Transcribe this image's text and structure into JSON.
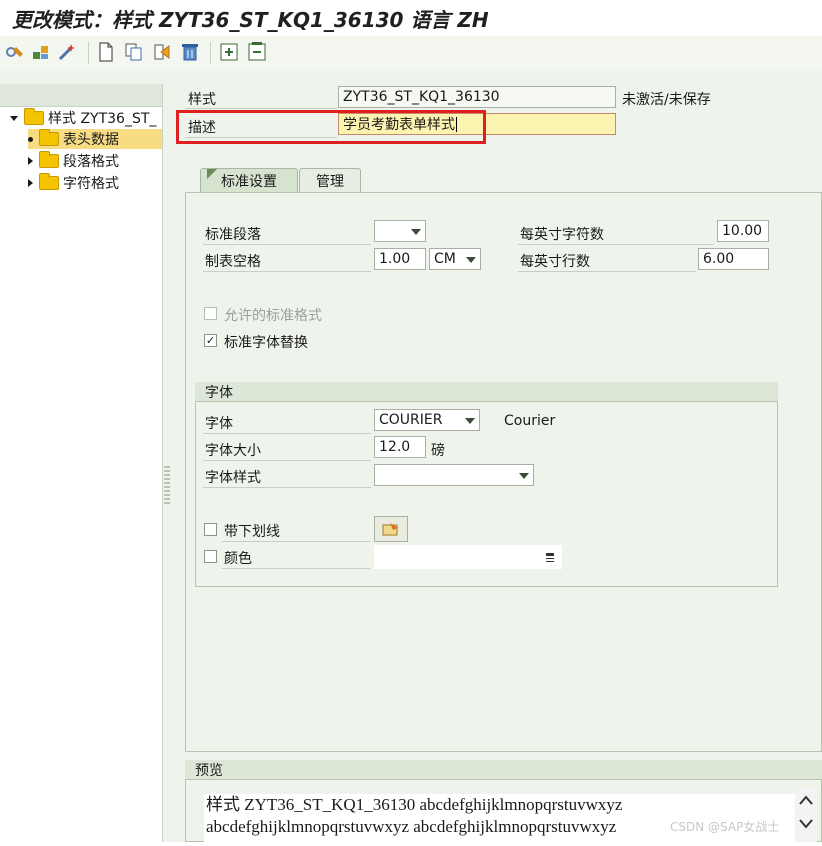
{
  "window": {
    "title": "更改模式：样式 ZYT36_ST_KQ1_36130 语言 ZH"
  },
  "tree": {
    "items": [
      {
        "label": "样式 ZYT36_ST_"
      },
      {
        "label": "表头数据"
      },
      {
        "label": "段落格式"
      },
      {
        "label": "字符格式"
      }
    ]
  },
  "header": {
    "style_label": "样式",
    "style_value": "ZYT36_ST_KQ1_36130",
    "status_text": "未激活/未保存",
    "desc_label": "描述",
    "desc_value": "学员考勤表单样式"
  },
  "tabs": [
    {
      "label": "标准设置",
      "active": true
    },
    {
      "label": "管理",
      "active": false
    }
  ],
  "standard": {
    "std_paragraph_label": "标准段落",
    "std_paragraph_value": "",
    "tab_spacing_label": "制表空格",
    "tab_spacing_value": "1.00",
    "tab_spacing_unit": "CM",
    "cpi_label": "每英寸字符数",
    "cpi_value": "10.00",
    "lpi_label": "每英寸行数",
    "lpi_value": "6.00",
    "allowed_formats_label": "允许的标准格式",
    "allowed_formats_checked": false,
    "font_replace_label": "标准字体替换",
    "font_replace_checked": true
  },
  "font_group": {
    "title": "字体",
    "family_label": "字体",
    "family_value": "COURIER",
    "family_desc": "Courier",
    "size_label": "字体大小",
    "size_value": "12.0",
    "size_unit": "磅",
    "style_label": "字体样式",
    "style_value": "",
    "underline_label": "带下划线",
    "underline_checked": false,
    "color_label": "颜色",
    "color_checked": false,
    "color_value": ""
  },
  "preview": {
    "title": "预览",
    "line1": "样式 ZYT36_ST_KQ1_36130 abcdefghijklmnopqrstuvwxyz",
    "line2": "abcdefghijklmnopqrstuvwxyz abcdefghijklmnopqrstuvwxyz"
  },
  "watermark": "CSDN @SAP女战士",
  "colors": {
    "highlight": "#e02020",
    "folder": "#f5c400",
    "selected_row": "#f7dc84",
    "input_active": "#fdf3b0"
  }
}
